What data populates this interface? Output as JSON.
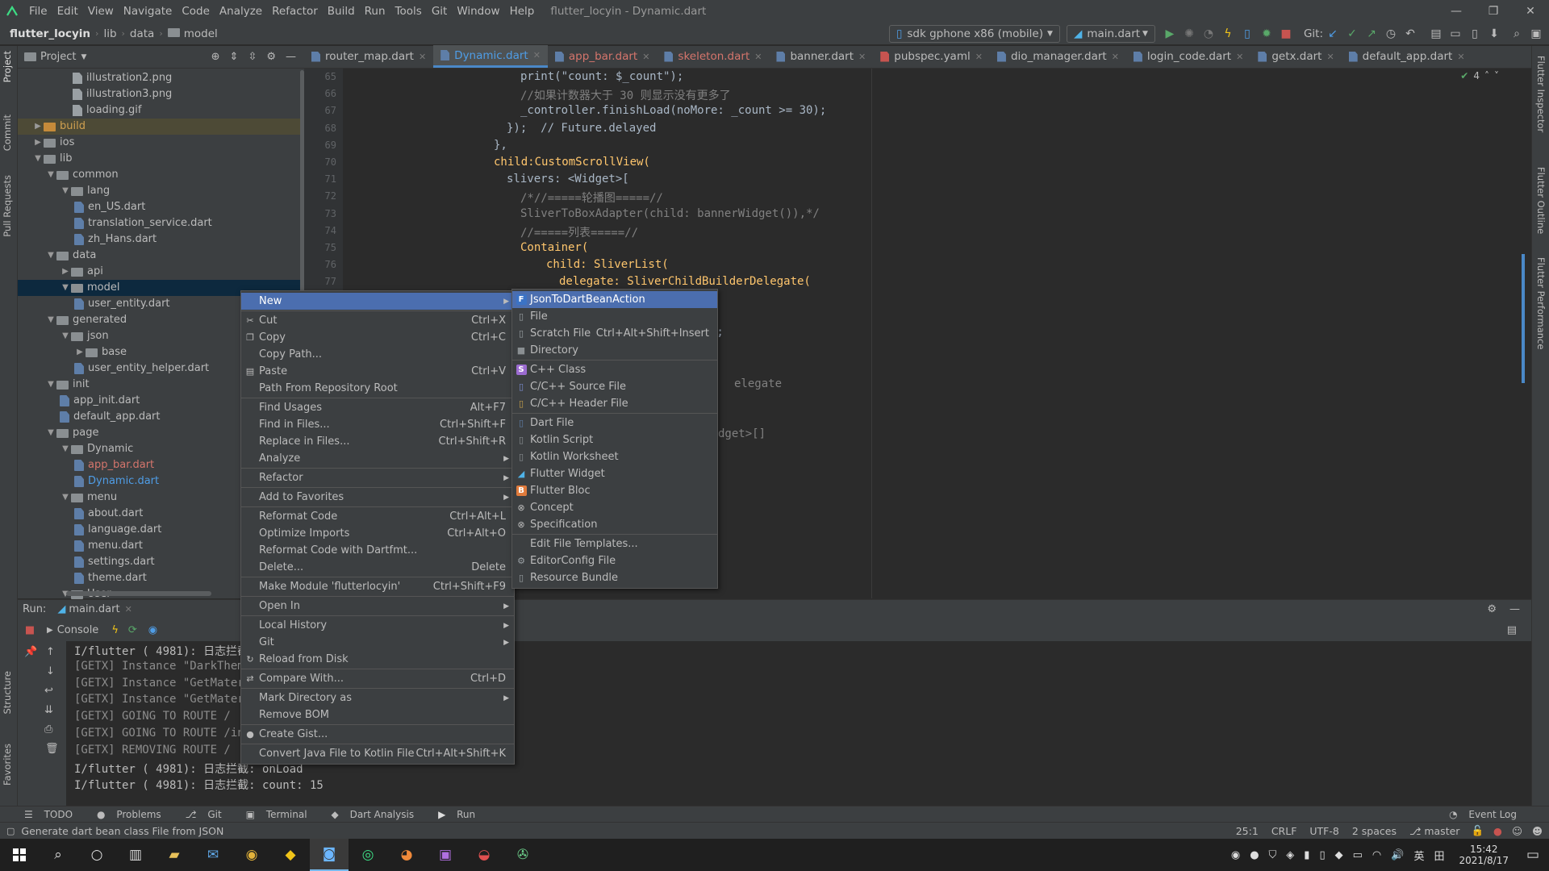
{
  "menubar": {
    "items": [
      "File",
      "Edit",
      "View",
      "Navigate",
      "Code",
      "Analyze",
      "Refactor",
      "Build",
      "Run",
      "Tools",
      "Git",
      "Window",
      "Help"
    ],
    "title": "flutter_locyin - Dynamic.dart"
  },
  "navbar": {
    "project": "flutter_locyin",
    "crumbs": [
      "lib",
      "data",
      "model"
    ],
    "device": "sdk gphone x86 (mobile)",
    "run_config": "main.dart",
    "git_label": "Git:"
  },
  "left_tabs": [
    "Project",
    "Commit",
    "Pull Requests",
    "Structure",
    "Favorites"
  ],
  "right_tabs": [
    "Flutter Inspector",
    "Flutter Outline",
    "Flutter Performance"
  ],
  "project_panel": {
    "title": "Project",
    "tree": [
      {
        "label": "illustration2.png",
        "type": "image"
      },
      {
        "label": "illustration3.png",
        "type": "image"
      },
      {
        "label": "loading.gif",
        "type": "image"
      },
      {
        "label": "build",
        "type": "folder-orange",
        "arrow": "▶"
      },
      {
        "label": "ios",
        "type": "folder",
        "arrow": "▶"
      },
      {
        "label": "lib",
        "type": "folder",
        "arrow": "▼"
      },
      {
        "label": "common",
        "type": "folder",
        "arrow": "▼"
      },
      {
        "label": "lang",
        "type": "folder",
        "arrow": "▼"
      },
      {
        "label": "en_US.dart",
        "type": "dart"
      },
      {
        "label": "translation_service.dart",
        "type": "dart"
      },
      {
        "label": "zh_Hans.dart",
        "type": "dart"
      },
      {
        "label": "data",
        "type": "folder",
        "arrow": "▼"
      },
      {
        "label": "api",
        "type": "folder",
        "arrow": "▶"
      },
      {
        "label": "model",
        "type": "folder",
        "arrow": "▼"
      },
      {
        "label": "user_entity.dart",
        "type": "dart"
      },
      {
        "label": "generated",
        "type": "folder",
        "arrow": "▼"
      },
      {
        "label": "json",
        "type": "folder",
        "arrow": "▼"
      },
      {
        "label": "base",
        "type": "folder",
        "arrow": "▶"
      },
      {
        "label": "user_entity_helper.dart",
        "type": "dart"
      },
      {
        "label": "init",
        "type": "folder",
        "arrow": "▼"
      },
      {
        "label": "app_init.dart",
        "type": "dart"
      },
      {
        "label": "default_app.dart",
        "type": "dart"
      },
      {
        "label": "page",
        "type": "folder",
        "arrow": "▼"
      },
      {
        "label": "Dynamic",
        "type": "folder",
        "arrow": "▼"
      },
      {
        "label": "app_bar.dart",
        "type": "dart"
      },
      {
        "label": "Dynamic.dart",
        "type": "dart"
      },
      {
        "label": "menu",
        "type": "folder",
        "arrow": "▼"
      },
      {
        "label": "about.dart",
        "type": "dart"
      },
      {
        "label": "language.dart",
        "type": "dart"
      },
      {
        "label": "menu.dart",
        "type": "dart"
      },
      {
        "label": "settings.dart",
        "type": "dart"
      },
      {
        "label": "theme.dart",
        "type": "dart"
      },
      {
        "label": "User",
        "type": "folder",
        "arrow": "▼"
      }
    ]
  },
  "editor_tabs": [
    {
      "label": "router_map.dart",
      "color": "#bbbbbb"
    },
    {
      "label": "Dynamic.dart",
      "color": "#4f9de6",
      "active": true
    },
    {
      "label": "app_bar.dart",
      "color": "#d5756c"
    },
    {
      "label": "skeleton.dart",
      "color": "#d5756c"
    },
    {
      "label": "banner.dart",
      "color": "#bbbbbb"
    },
    {
      "label": "pubspec.yaml",
      "color": "#bbbbbb"
    },
    {
      "label": "dio_manager.dart",
      "color": "#bbbbbb"
    },
    {
      "label": "login_code.dart",
      "color": "#bbbbbb"
    },
    {
      "label": "getx.dart",
      "color": "#bbbbbb"
    },
    {
      "label": "default_app.dart",
      "color": "#bbbbbb"
    }
  ],
  "editor": {
    "inspection_count": "4",
    "line_numbers": [
      "65",
      "66",
      "67",
      "68",
      "69",
      "70",
      "71",
      "72",
      "73",
      "74",
      "75",
      "76",
      "77"
    ],
    "code_lines": [
      "print(\"count: $_count\");",
      "//如果计数器大于 30 则显示没有更多了",
      "_controller.finishLoad(noMore: _count >= 30);",
      "});  // Future.delayed",
      "},",
      "child:CustomScrollView(",
      "slivers: <Widget>[",
      "/*//=====轮播图=====//",
      "SliverToBoxAdapter(child: bannerWidget()),*/",
      "//=====列表=====//",
      "Container(",
      "child: SliverList(",
      "delegate: SliverChildBuilderDelegate("
    ],
    "partial_fragments": [
      ");",
      "elegate",
      "dget>[]"
    ]
  },
  "context_menu": [
    {
      "label": "New",
      "selected": true,
      "submenu": true
    },
    {
      "sep": true
    },
    {
      "label": "Cut",
      "shortcut": "Ctrl+X",
      "icon": "✂"
    },
    {
      "label": "Copy",
      "shortcut": "Ctrl+C",
      "icon": "❐"
    },
    {
      "label": "Copy Path..."
    },
    {
      "label": "Paste",
      "shortcut": "Ctrl+V",
      "icon": "▤"
    },
    {
      "label": "Path From Repository Root"
    },
    {
      "sep": true
    },
    {
      "label": "Find Usages",
      "shortcut": "Alt+F7"
    },
    {
      "label": "Find in Files...",
      "shortcut": "Ctrl+Shift+F"
    },
    {
      "label": "Replace in Files...",
      "shortcut": "Ctrl+Shift+R"
    },
    {
      "label": "Analyze",
      "submenu": true
    },
    {
      "sep": true
    },
    {
      "label": "Refactor",
      "submenu": true
    },
    {
      "sep": true
    },
    {
      "label": "Add to Favorites",
      "submenu": true
    },
    {
      "sep": true
    },
    {
      "label": "Reformat Code",
      "shortcut": "Ctrl+Alt+L"
    },
    {
      "label": "Optimize Imports",
      "shortcut": "Ctrl+Alt+O"
    },
    {
      "label": "Reformat Code with Dartfmt..."
    },
    {
      "label": "Delete...",
      "shortcut": "Delete"
    },
    {
      "sep": true
    },
    {
      "label": "Make Module 'flutterlocyin'",
      "shortcut": "Ctrl+Shift+F9"
    },
    {
      "sep": true
    },
    {
      "label": "Open In",
      "submenu": true
    },
    {
      "sep": true
    },
    {
      "label": "Local History",
      "submenu": true
    },
    {
      "label": "Git",
      "submenu": true
    },
    {
      "label": "Reload from Disk",
      "icon": "↻"
    },
    {
      "sep": true
    },
    {
      "label": "Compare With...",
      "shortcut": "Ctrl+D",
      "icon": "⇄"
    },
    {
      "sep": true
    },
    {
      "label": "Mark Directory as",
      "submenu": true
    },
    {
      "label": "Remove BOM"
    },
    {
      "sep": true
    },
    {
      "label": "Create Gist...",
      "icon": "●"
    },
    {
      "sep": true
    },
    {
      "label": "Convert Java File to Kotlin File",
      "shortcut": "Ctrl+Alt+Shift+K"
    }
  ],
  "new_submenu": [
    {
      "label": "JsonToDartBeanAction",
      "selected": true,
      "icon": "F",
      "icon_color": "#3b73c5"
    },
    {
      "label": "File",
      "icon": "▯",
      "icon_color": "#9aa0a4"
    },
    {
      "label": "Scratch File",
      "shortcut": "Ctrl+Alt+Shift+Insert",
      "icon": "▯",
      "icon_color": "#9aa0a4"
    },
    {
      "label": "Directory",
      "icon": "■",
      "icon_color": "#8a8f92"
    },
    {
      "sep": true
    },
    {
      "label": "C++ Class",
      "icon": "S",
      "icon_color": "#9b6bd0"
    },
    {
      "label": "C/C++ Source File",
      "icon": "▯",
      "icon_color": "#7a8bd0"
    },
    {
      "label": "C/C++ Header File",
      "icon": "▯",
      "icon_color": "#c9a24a"
    },
    {
      "sep": true
    },
    {
      "label": "Dart File",
      "icon": "▯",
      "icon_color": "#5e7ea8"
    },
    {
      "label": "Kotlin Script",
      "icon": "▯",
      "icon_color": "#8a8f92"
    },
    {
      "label": "Kotlin Worksheet",
      "icon": "▯",
      "icon_color": "#8a8f92"
    },
    {
      "label": "Flutter Widget",
      "icon": "◢",
      "icon_color": "#4fb3e8"
    },
    {
      "label": "Flutter Bloc",
      "icon": "B",
      "icon_color": "#e07b3c"
    },
    {
      "label": "Concept",
      "icon": "⊗",
      "icon_color": "#bbbbbb"
    },
    {
      "label": "Specification",
      "icon": "⊗",
      "icon_color": "#bbbbbb"
    },
    {
      "sep": true
    },
    {
      "label": "Edit File Templates..."
    },
    {
      "label": "EditorConfig File",
      "icon": "⚙",
      "icon_color": "#9aa0a4"
    },
    {
      "label": "Resource Bundle",
      "icon": "▯",
      "icon_color": "#9aa0a4"
    }
  ],
  "run_panel": {
    "label": "Run:",
    "tab": "main.dart",
    "console_tab": "Console",
    "lines": [
      {
        "text": "I/flutter ( 4981): 日志拦截",
        "gray": false
      },
      {
        "text": "[GETX] Instance \"DarkTheme",
        "gray": true
      },
      {
        "text": "[GETX] Instance \"GetMateri",
        "gray": true
      },
      {
        "text": "[GETX] Instance \"GetMateri",
        "gray": true
      },
      {
        "text": "[GETX] GOING TO ROUTE /",
        "gray": true
      },
      {
        "text": "[GETX] GOING TO ROUTE /inc",
        "gray": true
      },
      {
        "text": "[GETX] REMOVING ROUTE /",
        "gray": true
      },
      {
        "text": "I/flutter ( 4981): 日志拦截: onLoad",
        "gray": false
      },
      {
        "text": "I/flutter ( 4981): 日志拦截: count: 15",
        "gray": false
      }
    ]
  },
  "tool_windows": [
    "TODO",
    "Problems",
    "Git",
    "Terminal",
    "Dart Analysis",
    "Run"
  ],
  "event_log": "Event Log",
  "status": {
    "message": "Generate dart bean class File from JSON",
    "position": "25:1",
    "line_sep": "CRLF",
    "encoding": "UTF-8",
    "indent": "2 spaces",
    "branch": "master"
  },
  "taskbar": {
    "ime": "英",
    "time": "15:42",
    "date": "2021/8/17"
  },
  "colors": {
    "accent": "#4b6eaf",
    "panel": "#3c3f41",
    "editor": "#2b2b2b"
  }
}
